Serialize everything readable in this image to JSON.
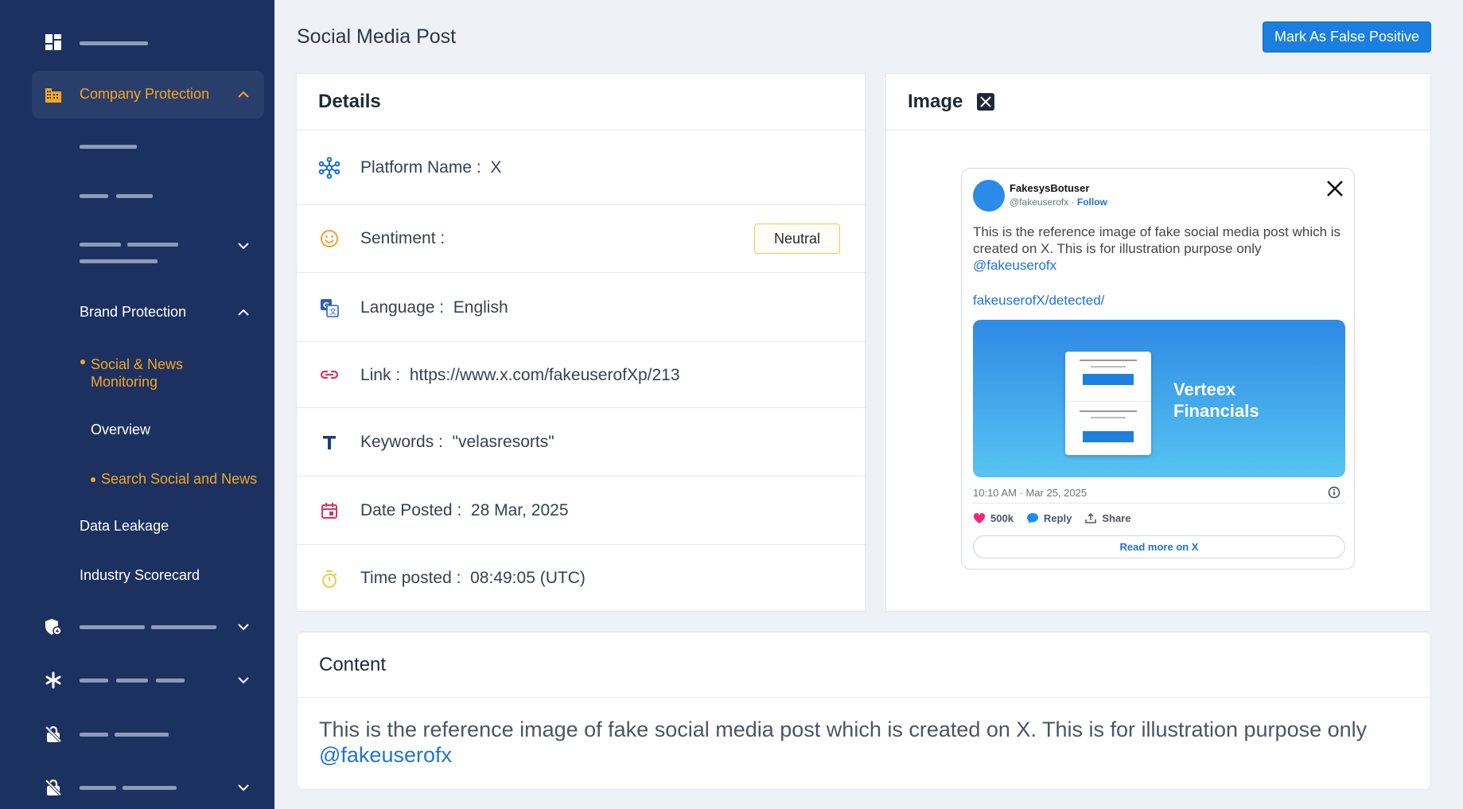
{
  "sidebar": {
    "company_protection": "Company Protection",
    "brand_protection": "Brand Protection",
    "social_news_monitoring": "Social & News Monitoring",
    "overview": "Overview",
    "search_social_news": "Search Social and News",
    "data_leakage": "Data Leakage",
    "industry_scorecard": "Industry Scorecard"
  },
  "header": {
    "title": "Social Media Post",
    "false_positive_button": "Mark As False Positive"
  },
  "details": {
    "title": "Details",
    "rows": [
      {
        "label": "Platform Name :",
        "value": "X",
        "icon": "network-icon"
      },
      {
        "label": "Sentiment :",
        "value": "Neutral",
        "icon": "smiley-icon"
      },
      {
        "label": "Language :",
        "value": "English",
        "icon": "translate-icon"
      },
      {
        "label": "Link :",
        "value": "https://www.x.com/fakeuserofXp/213",
        "icon": "link-icon"
      },
      {
        "label": "Keywords :",
        "value": "\"velasresorts\"",
        "icon": "text-icon"
      },
      {
        "label": "Date Posted :",
        "value": "28 Mar, 2025",
        "icon": "calendar-icon"
      },
      {
        "label": "Time posted :",
        "value": "08:49:05 (UTC)",
        "icon": "timer-icon"
      }
    ]
  },
  "image_card": {
    "title": "Image",
    "tweet": {
      "user_name": "FakesysBotuser",
      "handle": "@fakeuserofx",
      "separator": " · ",
      "follow": "Follow",
      "text": "This is the reference image of fake social media post which is created on X. This is for illustration purpose only",
      "mention": "@fakeuserofx",
      "link": "fakeuserofX/detected/",
      "brand_line1": "Verteex",
      "brand_line2": "Financials",
      "timestamp": "10:10 AM · Mar 25, 2025",
      "likes": "500k",
      "reply": "Reply",
      "share": "Share",
      "read_more": "Read more on X"
    }
  },
  "content": {
    "title": "Content",
    "text": "This is the reference image of fake social media post which is created on X. This is for illustration purpose only",
    "mention": "@fakeuserofx"
  },
  "colors": {
    "sidebar_bg": "#1c3160",
    "accent_orange": "#f5a623",
    "primary_blue": "#1a7fe0",
    "link_blue": "#1d74d6"
  }
}
